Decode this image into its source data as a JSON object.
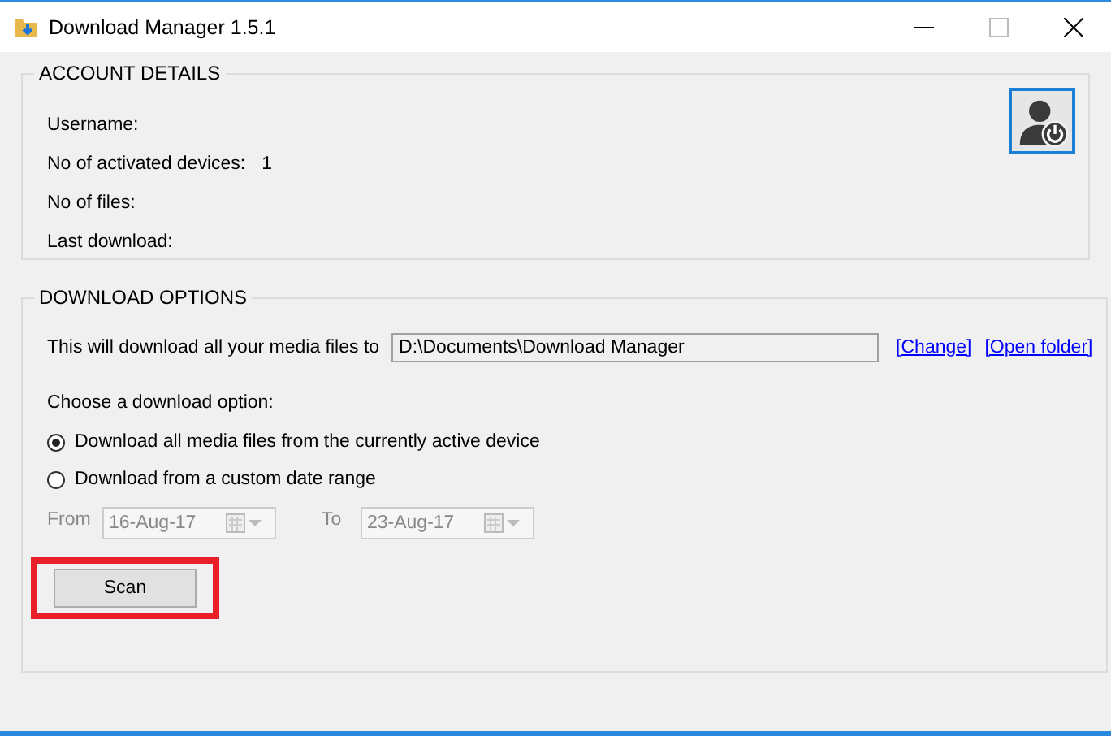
{
  "window": {
    "title": "Download Manager 1.5.1"
  },
  "account": {
    "legend": "ACCOUNT DETAILS",
    "fields": [
      {
        "label": "Username:"
      },
      {
        "label": "No of activated devices:",
        "value": "1"
      },
      {
        "label": "No of files:"
      },
      {
        "label": "Last download:"
      }
    ]
  },
  "options": {
    "legend": "DOWNLOAD OPTIONS",
    "path_label": "This will download all your media files to",
    "path": "D:\\Documents\\Download Manager",
    "links": [
      "[Change]",
      "[Open folder]"
    ],
    "choose_label": "Choose a download option:",
    "radios": [
      {
        "label": "Download all media files from the currently active device",
        "selected": true
      },
      {
        "label": "Download from a custom date range",
        "selected": false
      }
    ],
    "dates": [
      {
        "label": "From",
        "value": "16-Aug-17",
        "disabled": true
      },
      {
        "label": "To",
        "value": "23-Aug-17",
        "disabled": true
      }
    ],
    "scan": {
      "label": "Scan",
      "highlighted": true
    }
  }
}
